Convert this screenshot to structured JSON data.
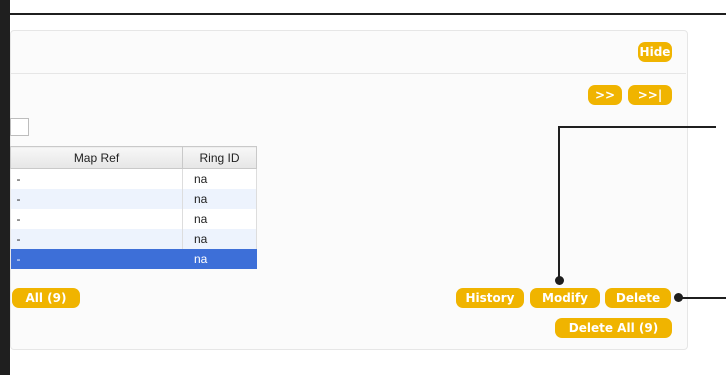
{
  "panel": {
    "hide_label": "Hide",
    "nav": {
      "next_label": ">>",
      "last_label": ">>|"
    }
  },
  "grid": {
    "columns": [
      "Map Ref",
      "Ring ID"
    ],
    "rows": [
      {
        "map_ref": "-",
        "ring_id": "na",
        "selected": false
      },
      {
        "map_ref": "-",
        "ring_id": "na",
        "selected": false
      },
      {
        "map_ref": "-",
        "ring_id": "na",
        "selected": false
      },
      {
        "map_ref": "-",
        "ring_id": "na",
        "selected": false
      },
      {
        "map_ref": "-",
        "ring_id": "na",
        "selected": true
      }
    ]
  },
  "actions": {
    "all_label": "All (9)",
    "history_label": "History",
    "modify_label": "Modify",
    "delete_label": "Delete",
    "delete_all_label": "Delete All (9)"
  },
  "colors": {
    "button": "#f0b400",
    "selection": "#3d6fd8",
    "alt_row": "#edf3fd",
    "frame": "#1f1f1f"
  }
}
